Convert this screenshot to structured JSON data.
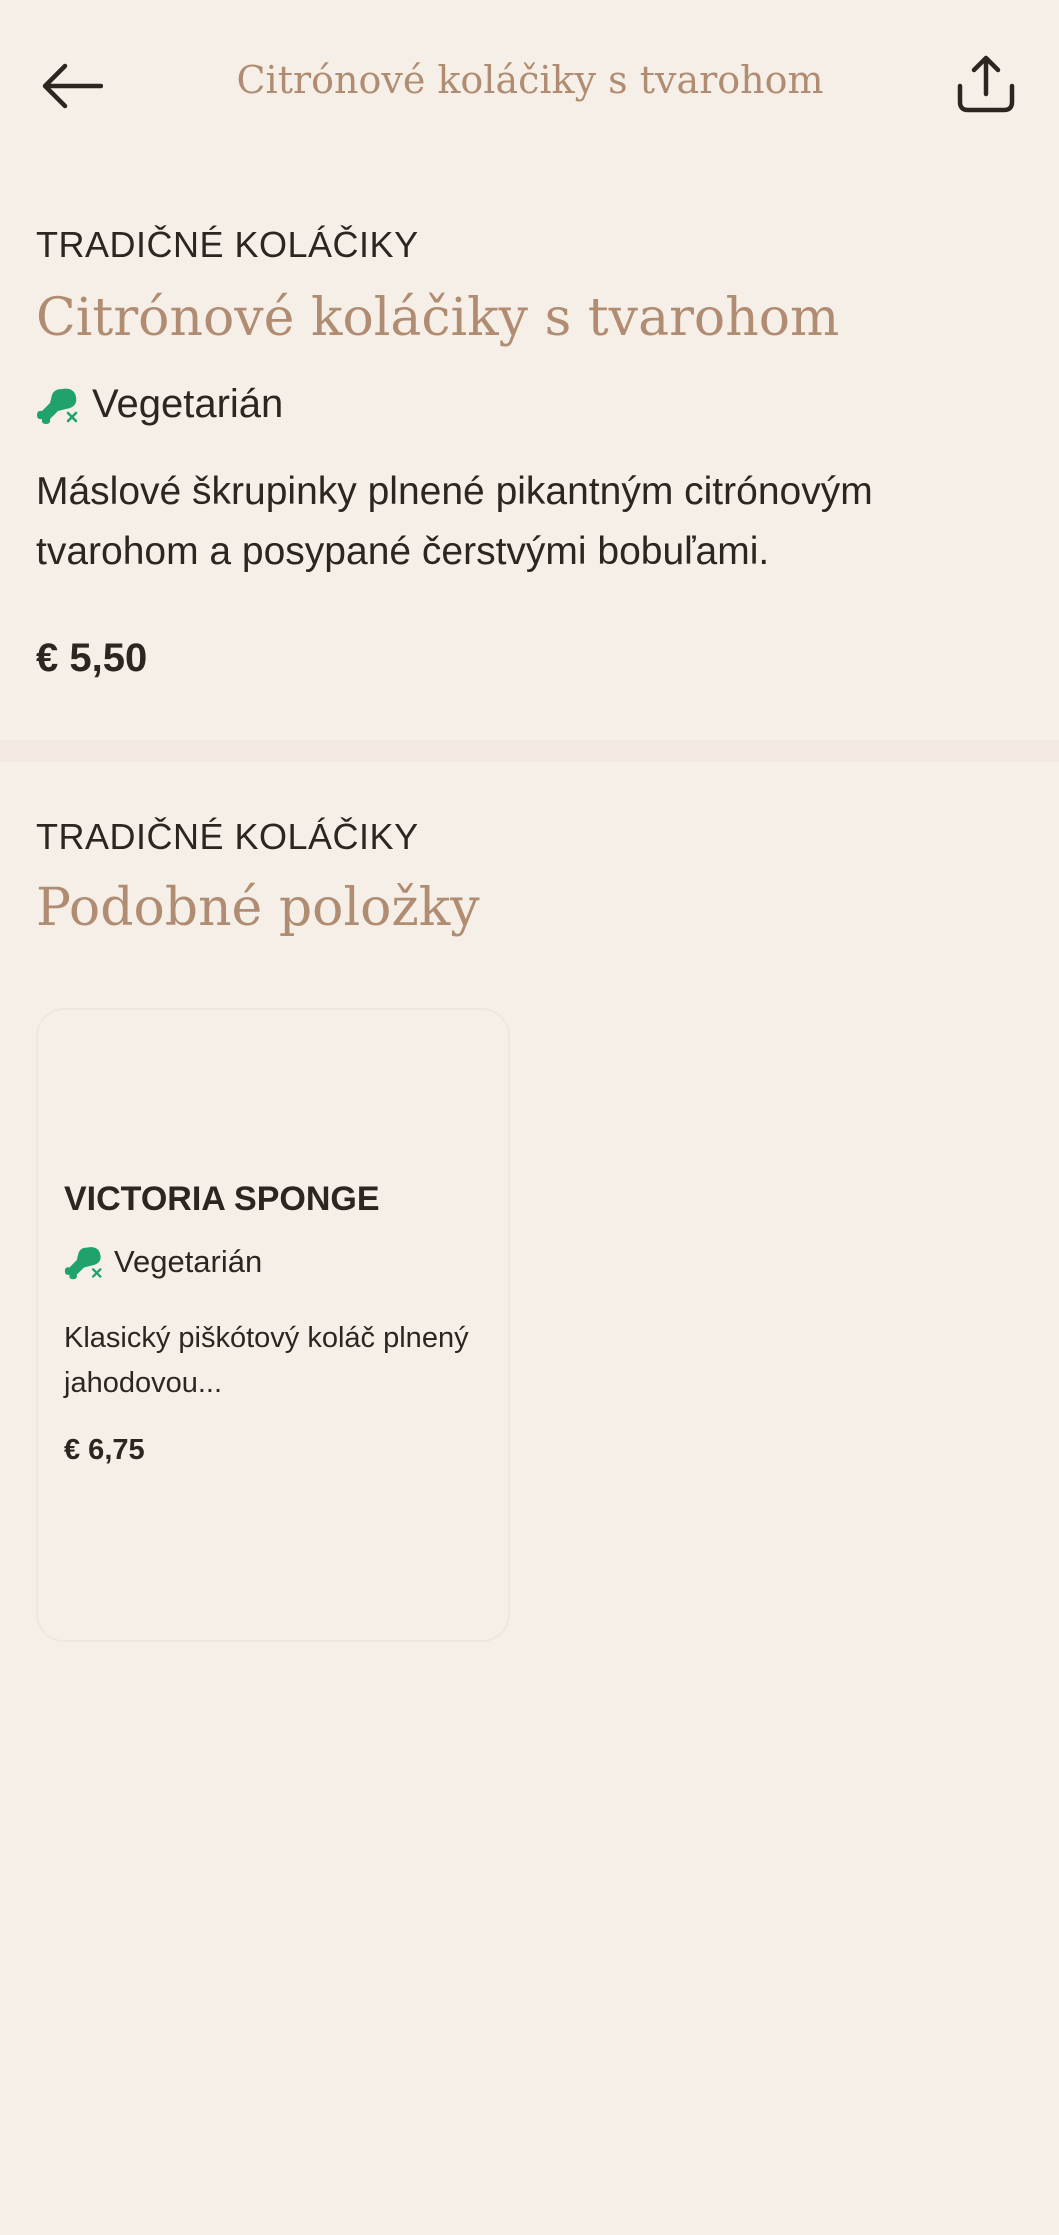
{
  "header": {
    "title": "Citrónové koláčiky s tvarohom",
    "back_icon": "arrow-left-icon",
    "share_icon": "share-icon"
  },
  "item": {
    "category": "TRADIČNÉ KOLÁČIKY",
    "name": "Citrónové koláčiky s tvarohom",
    "diet": "Vegetarián",
    "diet_icon": "vegetarian-drumstick-icon",
    "description": "Máslové škrupinky plnené pikantným citrónovým tvarohom a posypané čerstvými bobuľami.",
    "price": "€ 5,50"
  },
  "similar": {
    "category": "TRADIČNÉ KOLÁČIKY",
    "title": "Podobné položky",
    "items": [
      {
        "name": "VICTORIA SPONGE",
        "diet": "Vegetarián",
        "description": "Klasický piškótový koláč plnený jahodovou...",
        "price": "€ 6,75"
      }
    ]
  },
  "colors": {
    "background": "#f6efe8",
    "accent": "#b08d72",
    "text": "#2f2520",
    "diet_green": "#1fa36a"
  }
}
